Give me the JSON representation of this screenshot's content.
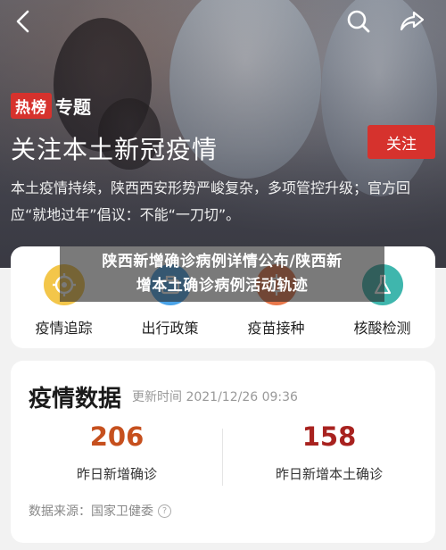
{
  "hero": {
    "tag_hot": "热榜",
    "tag_topic": "专题",
    "title": "关注本土新冠疫情",
    "follow_label": "关注",
    "description": "本土疫情持续，陕西西安形势严峻复杂，多项管控升级；官方回应“就地过年”倡议：不能“一刀切”。"
  },
  "topbar": {
    "back_icon": "chevron-left-icon",
    "search_icon": "search-icon",
    "share_icon": "share-icon"
  },
  "nav": {
    "items": [
      {
        "label": "疫情追踪",
        "icon": "target-icon",
        "color": "#f3c64a"
      },
      {
        "label": "出行政策",
        "icon": "travel-icon",
        "color": "#4aa3e8"
      },
      {
        "label": "疫苗接种",
        "icon": "vaccine-icon",
        "color": "#e8774a"
      },
      {
        "label": "核酸检测",
        "icon": "flask-icon",
        "color": "#3fb6ad"
      }
    ]
  },
  "banner": {
    "line1": "陕西新增确诊病例详情公布/陕西新",
    "line2": "增本土确诊病例活动轨迹"
  },
  "stats": {
    "title": "疫情数据",
    "update_time": "更新时间 2021/12/26 09:36",
    "new_confirmed_value": "206",
    "new_confirmed_label": "昨日新增确诊",
    "new_local_value": "158",
    "new_local_label": "昨日新增本土确诊",
    "source": "数据来源：国家卫健委"
  },
  "colors": {
    "accent_red": "#d6322d",
    "stat_orange": "#c6501e",
    "stat_red": "#a8221f"
  }
}
